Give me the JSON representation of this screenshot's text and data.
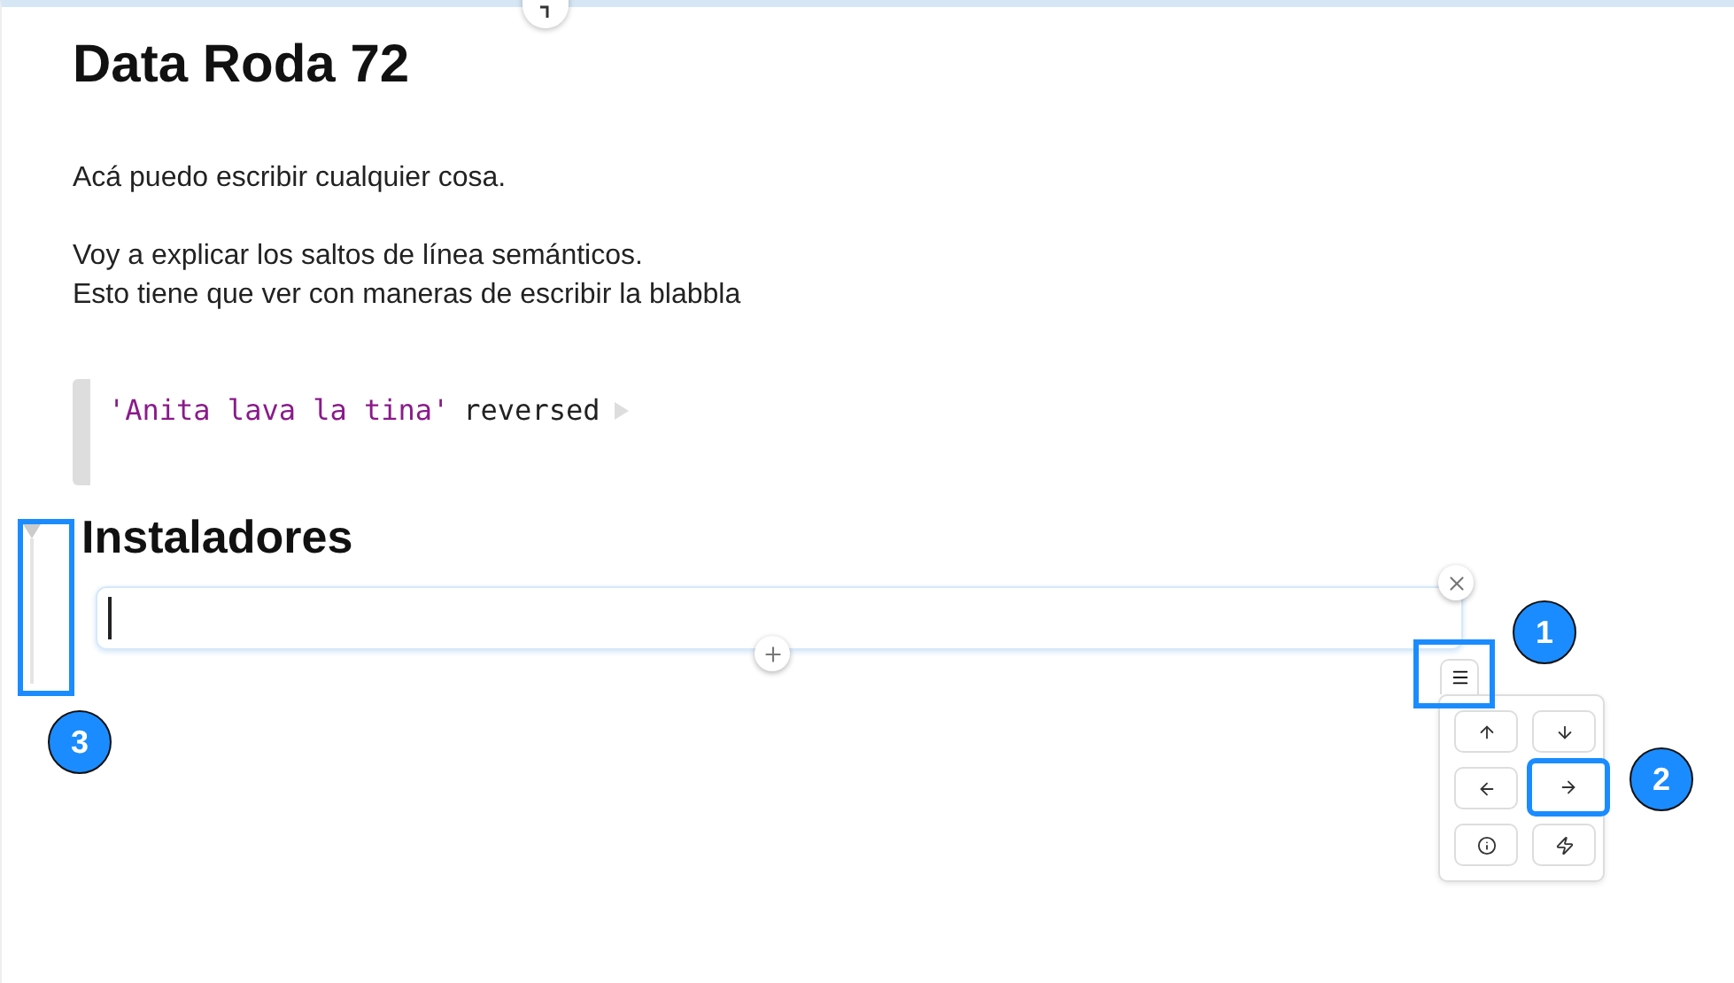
{
  "title": "Data Roda 72",
  "paragraphs": [
    [
      "Acá puedo escribir cualquier cosa."
    ],
    [
      "Voy a explicar los saltos de línea semánticos.",
      "Esto tiene que ver con maneras de escribir  la blabbla"
    ]
  ],
  "code": {
    "string": "'Anita lava la tina'",
    "message": "reversed"
  },
  "section": {
    "title": "Instaladores",
    "expanded": true
  },
  "palette": [
    {
      "kind": "up",
      "highlighted": false
    },
    {
      "kind": "down",
      "highlighted": false
    },
    {
      "kind": "left",
      "highlighted": false
    },
    {
      "kind": "right",
      "highlighted": true
    },
    {
      "kind": "info",
      "highlighted": false
    },
    {
      "kind": "bolt",
      "highlighted": false
    }
  ],
  "callouts": [
    "1",
    "2",
    "3"
  ]
}
